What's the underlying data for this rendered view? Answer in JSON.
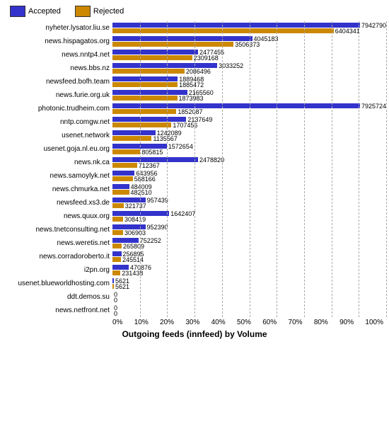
{
  "legend": {
    "accepted_label": "Accepted",
    "rejected_label": "Rejected"
  },
  "title": "Outgoing feeds (innfeed) by Volume",
  "x_axis_labels": [
    "0%",
    "10%",
    "20%",
    "30%",
    "40%",
    "50%",
    "60%",
    "70%",
    "80%",
    "90%",
    "100%"
  ],
  "max_value": 7925724,
  "rows": [
    {
      "label": "nyheter.lysator.liu.se",
      "accepted": 7942790,
      "rejected": 6404341
    },
    {
      "label": "news.hispagatos.org",
      "accepted": 4045183,
      "rejected": 3506373
    },
    {
      "label": "news.nntp4.net",
      "accepted": 2477455,
      "rejected": 2309168
    },
    {
      "label": "news.bbs.nz",
      "accepted": 3033252,
      "rejected": 2086496
    },
    {
      "label": "newsfeed.bofh.team",
      "accepted": 1889468,
      "rejected": 1885472
    },
    {
      "label": "news.furie.org.uk",
      "accepted": 2165560,
      "rejected": 1873983
    },
    {
      "label": "photonic.trudheim.com",
      "accepted": 7925724,
      "rejected": 1852087
    },
    {
      "label": "nntp.comgw.net",
      "accepted": 2137649,
      "rejected": 1707456
    },
    {
      "label": "usenet.network",
      "accepted": 1242089,
      "rejected": 1135567
    },
    {
      "label": "usenet.goja.nl.eu.org",
      "accepted": 1572654,
      "rejected": 805815
    },
    {
      "label": "news.nk.ca",
      "accepted": 2478820,
      "rejected": 712367
    },
    {
      "label": "news.samoylyk.net",
      "accepted": 643956,
      "rejected": 588166
    },
    {
      "label": "news.chmurka.net",
      "accepted": 484009,
      "rejected": 482510
    },
    {
      "label": "newsfeed.xs3.de",
      "accepted": 957439,
      "rejected": 321737
    },
    {
      "label": "news.quux.org",
      "accepted": 1642407,
      "rejected": 308419
    },
    {
      "label": "news.tnetconsulting.net",
      "accepted": 952390,
      "rejected": 306903
    },
    {
      "label": "news.weretis.net",
      "accepted": 752252,
      "rejected": 265809
    },
    {
      "label": "news.corradoroberto.it",
      "accepted": 256895,
      "rejected": 245514
    },
    {
      "label": "i2pn.org",
      "accepted": 470876,
      "rejected": 231438
    },
    {
      "label": "usenet.blueworldhosting.com",
      "accepted": 5621,
      "rejected": 5621
    },
    {
      "label": "ddt.demos.su",
      "accepted": 0,
      "rejected": 0
    },
    {
      "label": "news.netfront.net",
      "accepted": 0,
      "rejected": 0
    }
  ]
}
